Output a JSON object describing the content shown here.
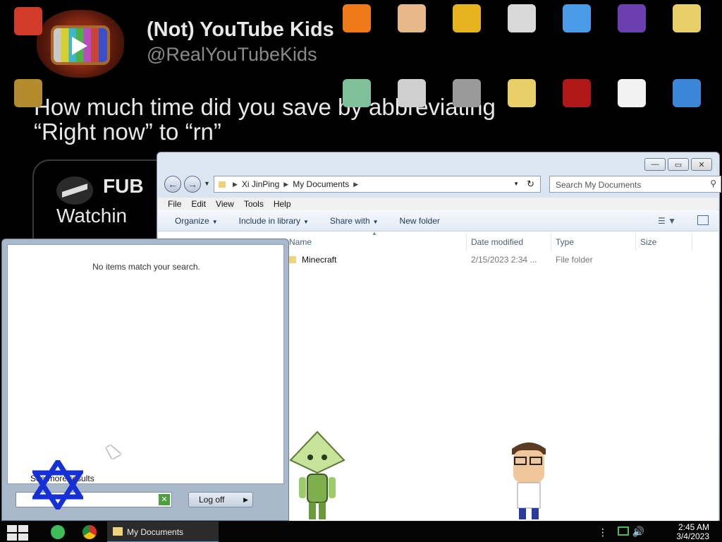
{
  "wallpaper": {
    "display_name": "(Not) YouTube Kids",
    "handle": "@RealYouTubeKids",
    "tweet_line1": "How much time did you save by abbreviating",
    "tweet_line2": "“Right now” to “rn”",
    "quote_name": "FUB",
    "quote_text": "Watchin"
  },
  "desktop_icons": [
    {
      "label": "",
      "icon": "angry-bird-icon",
      "color": "#d23a2a"
    },
    {
      "label": "",
      "icon": "avast-icon",
      "color": "#f07a17"
    },
    {
      "label": "",
      "icon": "support-person-icon",
      "color": "#e7b98a"
    },
    {
      "label": "",
      "icon": "de-logo-icon",
      "color": "#e6b31e"
    },
    {
      "label": "",
      "icon": "hxd-icon",
      "color": "#d8d8d8"
    },
    {
      "label": "",
      "icon": "browser-icon",
      "color": "#4a9be8"
    },
    {
      "label": "",
      "icon": "cpuz-icon",
      "color": "#6b3fb0"
    },
    {
      "label": "",
      "icon": "user-folder-icon",
      "color": "#e9cf6a"
    },
    {
      "label": "",
      "icon": "seven-zip-icon",
      "color": "#b38b2f"
    },
    {
      "label": "",
      "icon": "window-app-icon",
      "color": "#7fbf9a"
    },
    {
      "label": "",
      "icon": "skull-icon",
      "color": "#cfcfcf"
    },
    {
      "label": "",
      "icon": "stacked-windows-icon",
      "color": "#9a9a9a"
    },
    {
      "label": "",
      "icon": "flash-folder-icon",
      "color": "#e8cf6a"
    },
    {
      "label": "",
      "icon": "emblem-icon",
      "color": "#b01818"
    },
    {
      "label": "",
      "icon": "document-icon",
      "color": "#f2f2f2"
    },
    {
      "label": "",
      "icon": "computer-icon",
      "color": "#3b86d6"
    }
  ],
  "explorer": {
    "controls": [
      "—",
      "▭",
      "✕"
    ],
    "breadcrumb": [
      "Xi JinPing",
      "My Documents"
    ],
    "search_placeholder": "Search My Documents",
    "menu": [
      "File",
      "Edit",
      "View",
      "Tools",
      "Help"
    ],
    "commands": {
      "organize": "Organize",
      "include": "Include in library",
      "share": "Share with",
      "new_folder": "New folder"
    },
    "columns": {
      "name": "Name",
      "date": "Date modified",
      "type": "Type",
      "size": "Size"
    },
    "rows": [
      {
        "name": "Minecraft",
        "date": "2/15/2023 2:34 ...",
        "type": "File folder",
        "size": ""
      }
    ]
  },
  "start_menu": {
    "no_items": "No items match your search.",
    "see_more": "See more results",
    "search_value": "",
    "log_off": "Log off"
  },
  "taskbar": {
    "open_window": "My Documents",
    "time": "2:45 AM",
    "date": "3/4/2023"
  }
}
